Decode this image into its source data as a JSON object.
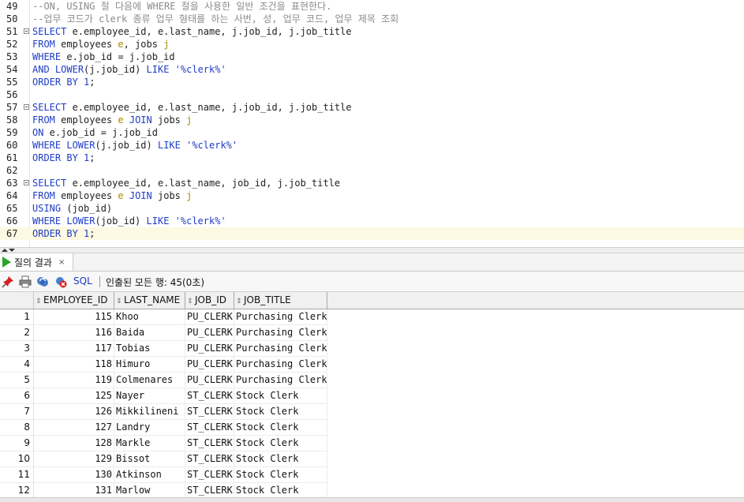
{
  "editor": {
    "current_line": 67,
    "lines": [
      {
        "num": "49",
        "fold": false,
        "tokens": [
          {
            "t": "cmt",
            "v": "--ON, USING 절 다음에 WHERE 절을 사용한 일반 조건을 표현한다."
          }
        ]
      },
      {
        "num": "50",
        "fold": false,
        "tokens": [
          {
            "t": "cmt",
            "v": "--업무 코드가 clerk 종류 업무 형태를 하는 사번, 성, 업무 코드, 업무 제목 조회"
          }
        ]
      },
      {
        "num": "51",
        "fold": true,
        "tokens": [
          {
            "t": "kw",
            "v": "SELECT"
          },
          {
            "t": "plain",
            "v": " e.employee_id, e.last_name, j.job_id, j.job_title"
          }
        ]
      },
      {
        "num": "52",
        "fold": false,
        "tokens": [
          {
            "t": "kw",
            "v": "FROM"
          },
          {
            "t": "plain",
            "v": " employees "
          },
          {
            "t": "alias",
            "v": "e"
          },
          {
            "t": "plain",
            "v": ", jobs "
          },
          {
            "t": "alias",
            "v": "j"
          }
        ]
      },
      {
        "num": "53",
        "fold": false,
        "tokens": [
          {
            "t": "kw",
            "v": "WHERE"
          },
          {
            "t": "plain",
            "v": " e.job_id = j.job_id"
          }
        ]
      },
      {
        "num": "54",
        "fold": false,
        "tokens": [
          {
            "t": "kw",
            "v": "AND"
          },
          {
            "t": "plain",
            "v": " "
          },
          {
            "t": "kw",
            "v": "LOWER"
          },
          {
            "t": "plain",
            "v": "(j.job_id) "
          },
          {
            "t": "kw",
            "v": "LIKE"
          },
          {
            "t": "plain",
            "v": " "
          },
          {
            "t": "str",
            "v": "'%clerk%'"
          }
        ]
      },
      {
        "num": "55",
        "fold": false,
        "tokens": [
          {
            "t": "kw",
            "v": "ORDER BY"
          },
          {
            "t": "plain",
            "v": " "
          },
          {
            "t": "num",
            "v": "1"
          },
          {
            "t": "plain",
            "v": ";"
          }
        ]
      },
      {
        "num": "56",
        "fold": false,
        "tokens": []
      },
      {
        "num": "57",
        "fold": true,
        "tokens": [
          {
            "t": "kw",
            "v": "SELECT"
          },
          {
            "t": "plain",
            "v": " e.employee_id, e.last_name, j.job_id, j.job_title"
          }
        ]
      },
      {
        "num": "58",
        "fold": false,
        "tokens": [
          {
            "t": "kw",
            "v": "FROM"
          },
          {
            "t": "plain",
            "v": " employees "
          },
          {
            "t": "alias",
            "v": "e"
          },
          {
            "t": "plain",
            "v": " "
          },
          {
            "t": "kw",
            "v": "JOIN"
          },
          {
            "t": "plain",
            "v": " jobs "
          },
          {
            "t": "alias",
            "v": "j"
          }
        ]
      },
      {
        "num": "59",
        "fold": false,
        "tokens": [
          {
            "t": "kw",
            "v": "ON"
          },
          {
            "t": "plain",
            "v": " e.job_id = j.job_id"
          }
        ]
      },
      {
        "num": "60",
        "fold": false,
        "tokens": [
          {
            "t": "kw",
            "v": "WHERE"
          },
          {
            "t": "plain",
            "v": " "
          },
          {
            "t": "kw",
            "v": "LOWER"
          },
          {
            "t": "plain",
            "v": "(j.job_id) "
          },
          {
            "t": "kw",
            "v": "LIKE"
          },
          {
            "t": "plain",
            "v": " "
          },
          {
            "t": "str",
            "v": "'%clerk%'"
          }
        ]
      },
      {
        "num": "61",
        "fold": false,
        "tokens": [
          {
            "t": "kw",
            "v": "ORDER BY"
          },
          {
            "t": "plain",
            "v": " "
          },
          {
            "t": "num",
            "v": "1"
          },
          {
            "t": "plain",
            "v": ";"
          }
        ]
      },
      {
        "num": "62",
        "fold": false,
        "tokens": []
      },
      {
        "num": "63",
        "fold": true,
        "tokens": [
          {
            "t": "kw",
            "v": "SELECT"
          },
          {
            "t": "plain",
            "v": " e.employee_id, e.last_name, job_id, j.job_title"
          }
        ]
      },
      {
        "num": "64",
        "fold": false,
        "tokens": [
          {
            "t": "kw",
            "v": "FROM"
          },
          {
            "t": "plain",
            "v": " employees "
          },
          {
            "t": "alias",
            "v": "e"
          },
          {
            "t": "plain",
            "v": " "
          },
          {
            "t": "kw",
            "v": "JOIN"
          },
          {
            "t": "plain",
            "v": " jobs "
          },
          {
            "t": "alias",
            "v": "j"
          }
        ]
      },
      {
        "num": "65",
        "fold": false,
        "tokens": [
          {
            "t": "kw",
            "v": "USING"
          },
          {
            "t": "plain",
            "v": " (job_id)"
          }
        ]
      },
      {
        "num": "66",
        "fold": false,
        "tokens": [
          {
            "t": "kw",
            "v": "WHERE"
          },
          {
            "t": "plain",
            "v": " "
          },
          {
            "t": "kw",
            "v": "LOWER"
          },
          {
            "t": "plain",
            "v": "(job_id) "
          },
          {
            "t": "kw",
            "v": "LIKE"
          },
          {
            "t": "plain",
            "v": " "
          },
          {
            "t": "str",
            "v": "'%clerk%'"
          }
        ]
      },
      {
        "num": "67",
        "fold": false,
        "tokens": [
          {
            "t": "kw",
            "v": "ORDER BY"
          },
          {
            "t": "plain",
            "v": " "
          },
          {
            "t": "num",
            "v": "1"
          },
          {
            "t": "plain",
            "v": ";"
          }
        ]
      }
    ]
  },
  "results_tab": {
    "label": "질의 결과",
    "close": "×"
  },
  "toolbar": {
    "sql_label": "SQL",
    "status": "인출된 모든 행: 45(0초)",
    "icons": [
      "pin-icon",
      "print-icon",
      "refresh-icon",
      "cancel-query-icon"
    ]
  },
  "grid": {
    "columns": [
      "EMPLOYEE_ID",
      "LAST_NAME",
      "JOB_ID",
      "JOB_TITLE"
    ],
    "rows": [
      {
        "n": "1",
        "id": "115",
        "last": "Khoo",
        "job": "PU_CLERK",
        "title": "Purchasing Clerk"
      },
      {
        "n": "2",
        "id": "116",
        "last": "Baida",
        "job": "PU_CLERK",
        "title": "Purchasing Clerk"
      },
      {
        "n": "3",
        "id": "117",
        "last": "Tobias",
        "job": "PU_CLERK",
        "title": "Purchasing Clerk"
      },
      {
        "n": "4",
        "id": "118",
        "last": "Himuro",
        "job": "PU_CLERK",
        "title": "Purchasing Clerk"
      },
      {
        "n": "5",
        "id": "119",
        "last": "Colmenares",
        "job": "PU_CLERK",
        "title": "Purchasing Clerk"
      },
      {
        "n": "6",
        "id": "125",
        "last": "Nayer",
        "job": "ST_CLERK",
        "title": "Stock Clerk"
      },
      {
        "n": "7",
        "id": "126",
        "last": "Mikkilineni",
        "job": "ST_CLERK",
        "title": "Stock Clerk"
      },
      {
        "n": "8",
        "id": "127",
        "last": "Landry",
        "job": "ST_CLERK",
        "title": "Stock Clerk"
      },
      {
        "n": "9",
        "id": "128",
        "last": "Markle",
        "job": "ST_CLERK",
        "title": "Stock Clerk"
      },
      {
        "n": "10",
        "id": "129",
        "last": "Bissot",
        "job": "ST_CLERK",
        "title": "Stock Clerk"
      },
      {
        "n": "11",
        "id": "130",
        "last": "Atkinson",
        "job": "ST_CLERK",
        "title": "Stock Clerk"
      },
      {
        "n": "12",
        "id": "131",
        "last": "Marlow",
        "job": "ST_CLERK",
        "title": "Stock Clerk"
      }
    ]
  }
}
